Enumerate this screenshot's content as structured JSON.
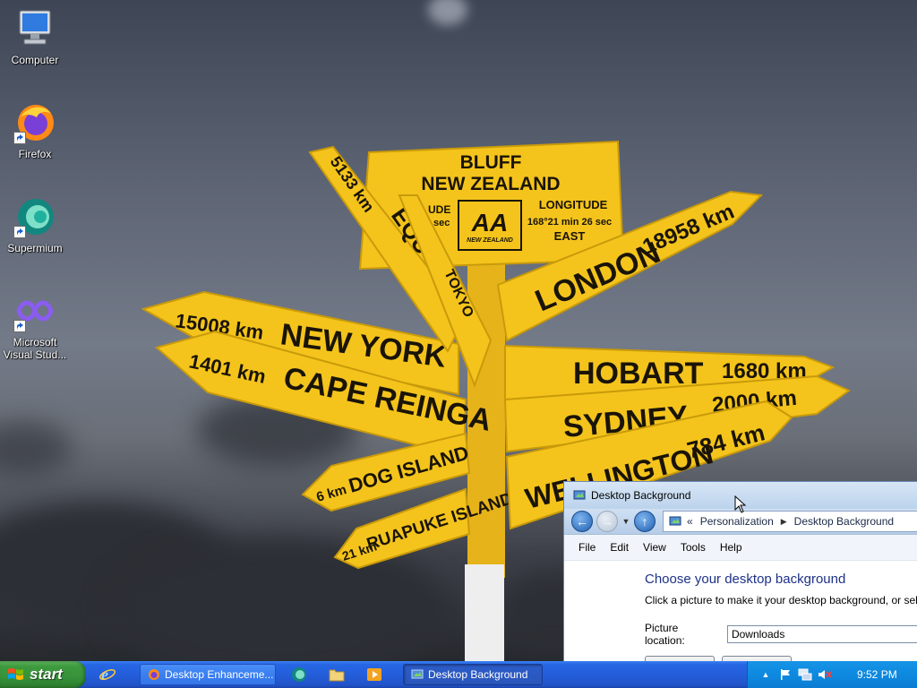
{
  "desktop": {
    "icons": [
      {
        "label": "Computer"
      },
      {
        "label": "Firefox"
      },
      {
        "label": "Supermium"
      },
      {
        "label": "Microsoft Visual Stud..."
      }
    ],
    "wallpaper": {
      "main_sign": {
        "line1": "BLUFF",
        "line2": "NEW ZEALAND",
        "logo": "AA",
        "logo_sub": "NEW ZEALAND",
        "right_label": "LONGITUDE",
        "right_value": "168°21 min 26 sec",
        "right_dir": "EAST",
        "left_partial": "UDE",
        "left_partial2": "sec"
      },
      "arms": [
        {
          "distance": "15008 km",
          "place": "NEW YORK"
        },
        {
          "distance": "1401 km",
          "place": "CAPE REINGA"
        },
        {
          "distance": "6 km",
          "place": "DOG ISLAND"
        },
        {
          "distance": "21 km",
          "place": "RUAPUKE ISLAND"
        },
        {
          "distance": "18958 km",
          "place": "LONDON"
        },
        {
          "distance": "1680 km",
          "place": "HOBART"
        },
        {
          "distance": "2000 km",
          "place": "SYDNEY"
        },
        {
          "distance": "784 km",
          "place": "WELLINGTON"
        },
        {
          "distance": "5133 km",
          "place": "EQU"
        },
        {
          "distance": "",
          "place": "TOKYO"
        }
      ]
    }
  },
  "window": {
    "title": "Desktop Background",
    "address": {
      "overflow": "«",
      "crumbs": [
        "Personalization",
        "Desktop Background"
      ]
    },
    "menu": [
      "File",
      "Edit",
      "View",
      "Tools",
      "Help"
    ],
    "heading": "Choose your desktop background",
    "description": "Click a picture to make it your desktop background, or sel",
    "picture_location_label": "Picture location:",
    "picture_location_value": "Downloads"
  },
  "taskbar": {
    "start_label": "start",
    "quick_launch": [
      "internet-explorer-icon",
      "supermium-icon",
      "folder-icon",
      "media-player-icon"
    ],
    "tasks": [
      {
        "label": "Desktop Enhanceme...",
        "active": false
      },
      {
        "label": "Desktop Background",
        "active": true
      }
    ],
    "tray": {
      "time": "9:52 PM"
    }
  },
  "colors": {
    "taskbar_blue": "#245edb",
    "start_green": "#3d9a3d",
    "tray_blue": "#0d8ae0",
    "sign_yellow": "#f5c518",
    "heading_blue": "#1e3287"
  }
}
